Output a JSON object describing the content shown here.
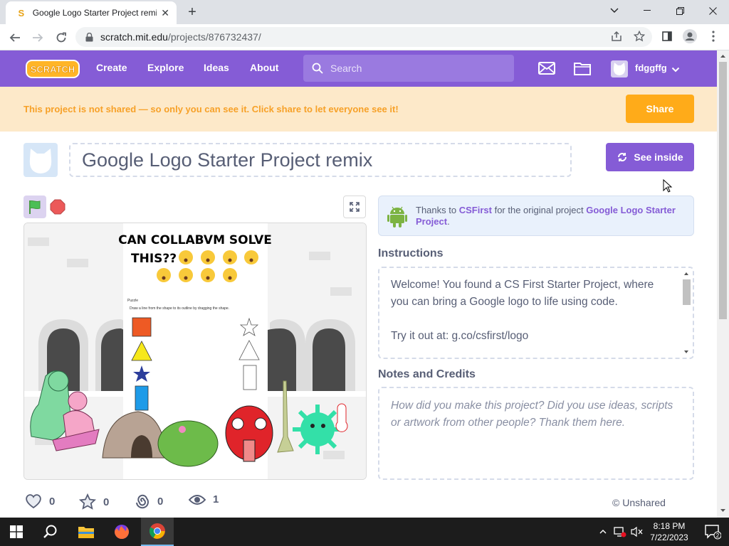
{
  "browser": {
    "tab_title": "Google Logo Starter Project remix",
    "tab_favicon": "S",
    "url_host": "scratch.mit.edu",
    "url_path": "/projects/876732437/"
  },
  "nav": {
    "logo_text": "SCRATCH",
    "links": [
      "Create",
      "Explore",
      "Ideas",
      "About"
    ],
    "search_placeholder": "Search",
    "username": "fdggffg"
  },
  "banner": {
    "message": "This project is not shared — so only you can see it. Click share to let everyone see it!",
    "share_label": "Share"
  },
  "project": {
    "title": "Google Logo Starter Project remix",
    "see_inside_label": "See inside"
  },
  "stage": {
    "card_title_line1": "CAN COLLABVM SOLVE",
    "card_title_line2": "THIS??",
    "card_small_label": "Puzzle",
    "card_instructions": "Draw a line from the shape to its outline by dragging the shape."
  },
  "remix": {
    "prefix": "Thanks to",
    "author": "CSFirst",
    "middle": "for the original project",
    "project": "Google Logo Starter Project",
    "suffix": "."
  },
  "instructions": {
    "heading": "Instructions",
    "line1": "Welcome! You found a CS First Starter Project, where you can bring a Google logo to life using code.",
    "line2": "Try it out at: g.co/csfirst/logo"
  },
  "notes": {
    "heading": "Notes and Credits",
    "placeholder": "How did you make this project? Did you use ideas, scripts or artwork from other people? Thank them here."
  },
  "stats": {
    "loves": "0",
    "favorites": "0",
    "remixes": "0",
    "views": "1",
    "sharing_status": "Unshared"
  },
  "taskbar": {
    "time": "8:18 PM",
    "date": "7/22/2023",
    "notification_count": "2"
  },
  "colors": {
    "scratch_purple": "#855cd6",
    "banner_bg": "#fde9c9",
    "banner_text": "#f7a128",
    "share_orange": "#ffab19"
  }
}
